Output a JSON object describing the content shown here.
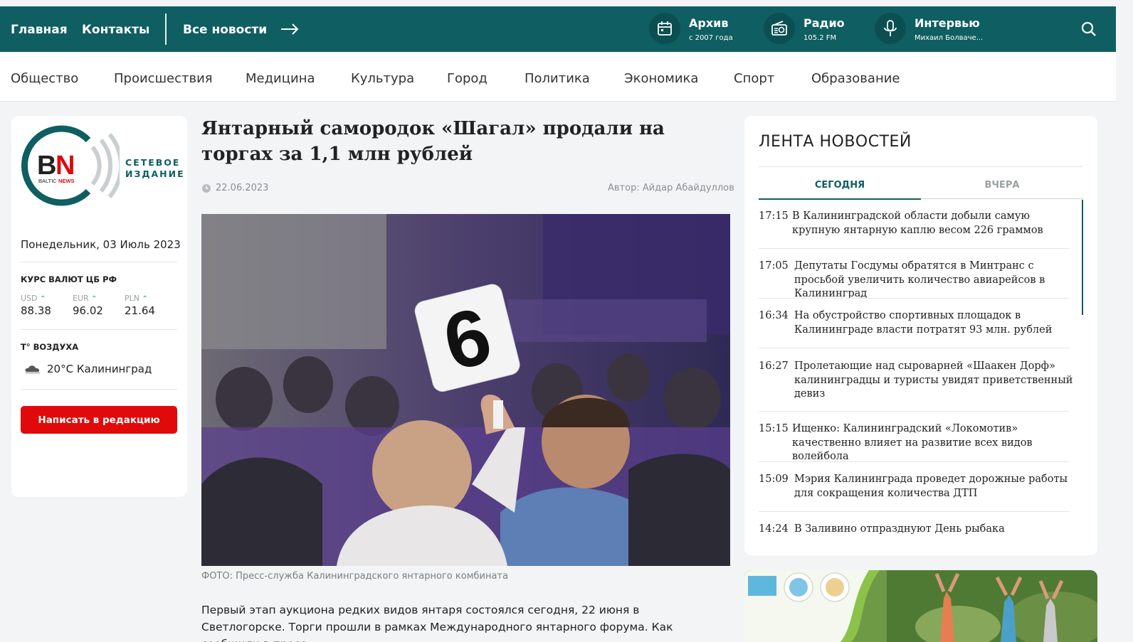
{
  "topbar": {
    "nav": [
      "Главная",
      "Контакты",
      "Все новости"
    ],
    "quick": [
      {
        "icon": "calendar-icon",
        "title": "Архив",
        "sub": "с 2007 года"
      },
      {
        "icon": "radio-icon",
        "title": "Радио",
        "sub": "105.2 FM"
      },
      {
        "icon": "microphone-icon",
        "title": "Интервью",
        "sub": "Михаил Болваче..."
      }
    ]
  },
  "rubrics": [
    "Общество",
    "Происшествия",
    "Медицина",
    "Культура",
    "Город",
    "Политика",
    "Экономика",
    "Спорт",
    "Образование"
  ],
  "sidebar": {
    "logo_letters": "BN",
    "logo_small": "BALTIC",
    "logo_small2": "NEWS",
    "logo_caption_1": "СЕТЕВОЕ",
    "logo_caption_2": "ИЗДАНИЕ",
    "date": "Понедельник, 03 Июль 2023",
    "currency_title": "КУРС ВАЛЮТ ЦБ РФ",
    "currencies": [
      {
        "code": "USD",
        "value": "88.38"
      },
      {
        "code": "EUR",
        "value": "96.02"
      },
      {
        "code": "PLN",
        "value": "21.64"
      }
    ],
    "weather_title": "T° ВОЗДУХА",
    "weather": "20°C Калининград",
    "write_button": "Написать в редакцию"
  },
  "article": {
    "title": "Янтарный самородок «Шагал» продали на торгах за 1,1 млн рублей",
    "date": "22.06.2023",
    "author": "Автор: Айдар Абайдуллов",
    "caption": "ФОТО: Пресс-служба Калининградского янтарного комбината",
    "paddle_number": "6",
    "body": "Первый этап аукциона редких видов янтаря состоялся сегодня, 22 июня в Светлогорске. Торги прошли в рамках Международного янтарного форума. Как сообщили в пресс-"
  },
  "feed": {
    "title": "ЛЕНТА НОВОСТЕЙ",
    "tabs": [
      "СЕГОДНЯ",
      "ВЧЕРА"
    ],
    "items": [
      {
        "time": "17:15",
        "text": "В Калининградской области добыли самую крупную янтарную каплю весом 226 граммов"
      },
      {
        "time": "17:05",
        "text": "Депутаты Госдумы обратятся в Минтранс с просьбой увеличить количество авиарейсов в Калининград"
      },
      {
        "time": "16:34",
        "text": "На обустройство спортивных площадок в Калининграде власти потратят 93 млн. рублей"
      },
      {
        "time": "16:27",
        "text": "Пролетающие над сыроварней «Шаакен Дорф» калининградцы и туристы увидят приветственный девиз"
      },
      {
        "time": "15:15",
        "text": "Ищенко: Калининградский «Локомотив» качественно влияет на развитие всех видов волейбола"
      },
      {
        "time": "15:09",
        "text": "Мэрия Калининграда проведет дорожные работы для сокращения количества ДТП"
      },
      {
        "time": "14:24",
        "text": "В Заливино отпразднуют День рыбака"
      }
    ]
  }
}
